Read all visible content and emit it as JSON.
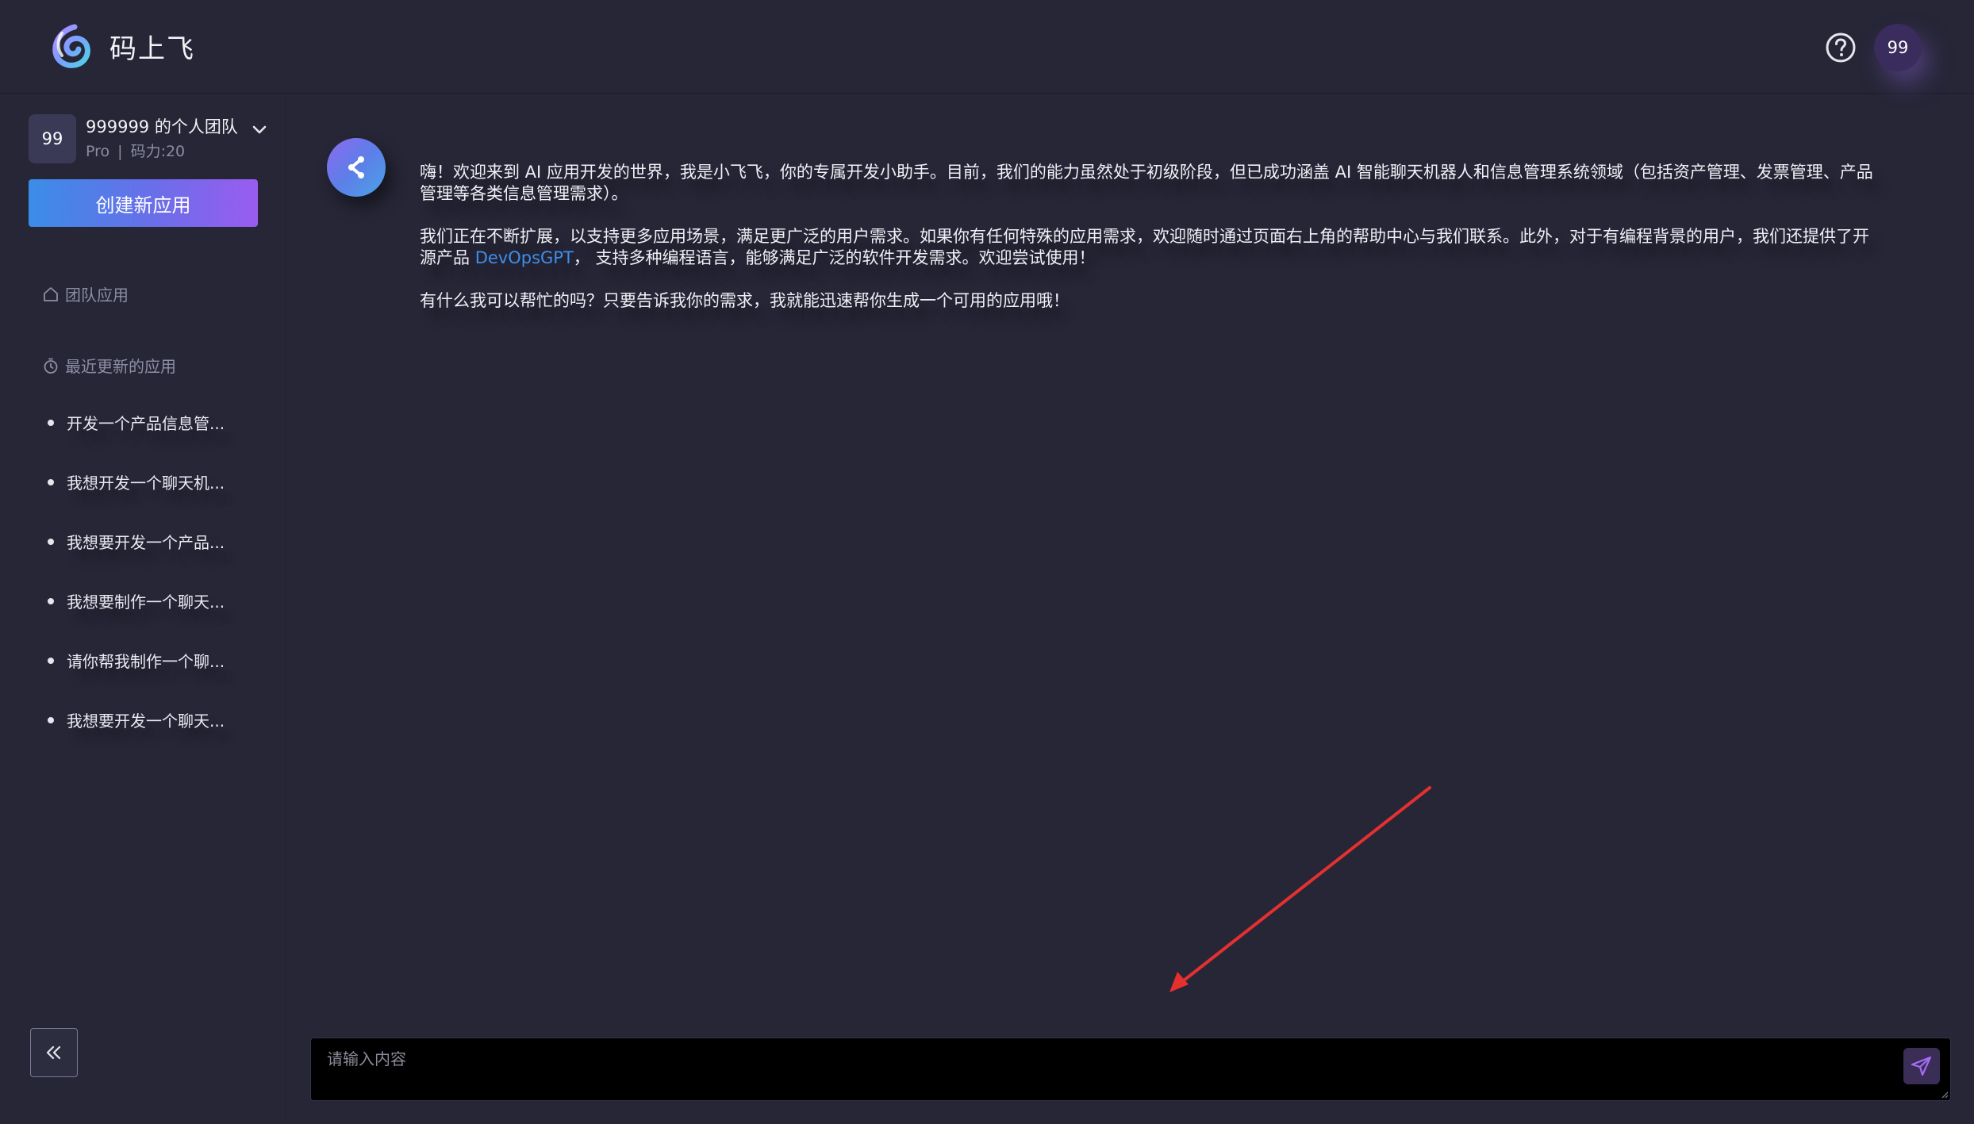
{
  "header": {
    "app_name": "码上飞",
    "help_icon": "question-circle-icon",
    "user_avatar": "99"
  },
  "sidebar": {
    "team": {
      "avatar": "99",
      "name": "999999 的个人团队",
      "plan": "Pro",
      "separator": "|",
      "power": "码力:20"
    },
    "create_button": "创建新应用",
    "nav": {
      "team_apps": "团队应用",
      "recent_apps": "最近更新的应用"
    },
    "recent_items": [
      "开发一个产品信息管...",
      "我想开发一个聊天机...",
      "我想要开发一个产品...",
      "我想要制作一个聊天...",
      "请你帮我制作一个聊...",
      "我想要开发一个聊天..."
    ],
    "collapse_icon": "double-chevron-left-icon"
  },
  "chat": {
    "para1": "嗨！欢迎来到 AI 应用开发的世界，我是小飞飞，你的专属开发小助手。目前，我们的能力虽然处于初级阶段，但已成功涵盖 AI 智能聊天机器人和信息管理系统领域（包括资产管理、发票管理、产品管理等各类信息管理需求）。",
    "para2_before": "我们正在不断扩展，以支持更多应用场景，满足更广泛的用户需求。如果你有任何特殊的应用需求，欢迎随时通过页面右上角的帮助中心与我们联系。此外，对于有编程背景的用户，我们还提供了开源产品 ",
    "para2_link": "DevOpsGPT",
    "para2_after": "， 支持多种编程语言，能够满足广泛的软件开发需求。欢迎尝试使用！",
    "para3": "有什么我可以帮忙的吗？只要告诉我你的需求，我就能迅速帮你生成一个可用的应用哦！"
  },
  "input": {
    "placeholder": "请输入内容",
    "value": "",
    "send_icon": "send-icon"
  },
  "colors": {
    "background": "#262637",
    "accent_blue": "#3f8eea",
    "accent_purple": "#9a5cf0",
    "annotation_arrow": "#e53030"
  }
}
